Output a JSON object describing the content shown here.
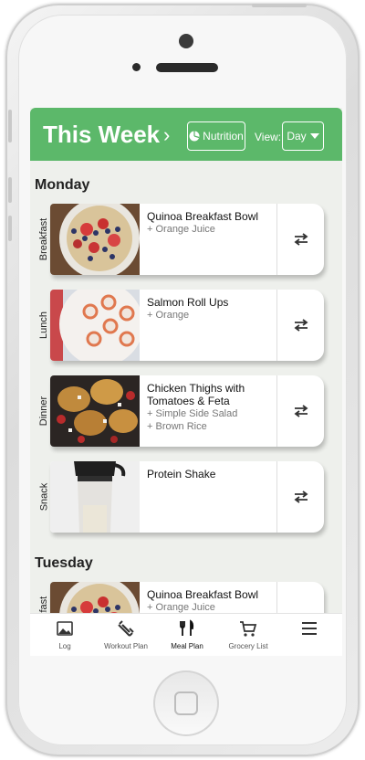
{
  "header": {
    "title": "This Week",
    "nutrition_label": "Nutrition",
    "view_label": "View:",
    "view_value": "Day",
    "accent_color": "#5cb86a"
  },
  "days": [
    {
      "name": "Monday",
      "meals": [
        {
          "type": "Breakfast",
          "name": "Quinoa Breakfast Bowl",
          "sides": [
            "+ Orange Juice"
          ],
          "image": "breakfast-bowl"
        },
        {
          "type": "Lunch",
          "name": "Salmon Roll Ups",
          "sides": [
            "+ Orange"
          ],
          "image": "salmon-roll-ups"
        },
        {
          "type": "Dinner",
          "name": "Chicken Thighs with Tomatoes & Feta",
          "sides": [
            "+ Simple Side Salad",
            "+ Brown Rice"
          ],
          "image": "chicken-thighs"
        },
        {
          "type": "Snack",
          "name": "Protein Shake",
          "sides": [],
          "image": "protein-shaker"
        }
      ]
    },
    {
      "name": "Tuesday",
      "meals": [
        {
          "type": "Breakfast",
          "name": "Quinoa Breakfast Bowl",
          "sides": [
            "+ Orange Juice"
          ],
          "image": "breakfast-bowl"
        }
      ]
    }
  ],
  "tabs": [
    {
      "label": "Log",
      "icon": "image-icon"
    },
    {
      "label": "Workout Plan",
      "icon": "dumbbell-icon"
    },
    {
      "label": "Meal Plan",
      "icon": "fork-knife-icon",
      "active": true
    },
    {
      "label": "Grocery List",
      "icon": "cart-icon"
    },
    {
      "label": "",
      "icon": "menu-icon"
    }
  ]
}
